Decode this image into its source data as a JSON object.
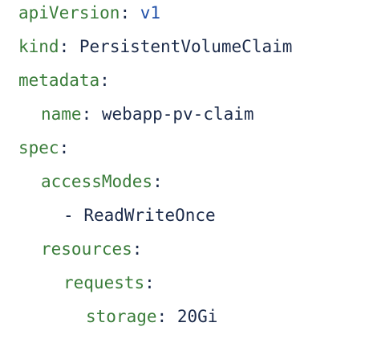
{
  "colors": {
    "key": "#3a7d3a",
    "value": "#1c2b4a",
    "version_value": "#1f4fa8",
    "background": "#ffffff"
  },
  "yaml": {
    "apiVersion": {
      "key": "apiVersion",
      "value": "v1"
    },
    "kind": {
      "key": "kind",
      "value": "PersistentVolumeClaim"
    },
    "metadata": {
      "key": "metadata"
    },
    "name": {
      "key": "name",
      "value": "webapp-pv-claim"
    },
    "spec": {
      "key": "spec"
    },
    "accessModes": {
      "key": "accessModes"
    },
    "accessMode_item": {
      "dash": "-",
      "value": "ReadWriteOnce"
    },
    "resources": {
      "key": "resources"
    },
    "requests": {
      "key": "requests"
    },
    "storage": {
      "key": "storage",
      "value": "20Gi"
    },
    "separator": ":"
  }
}
